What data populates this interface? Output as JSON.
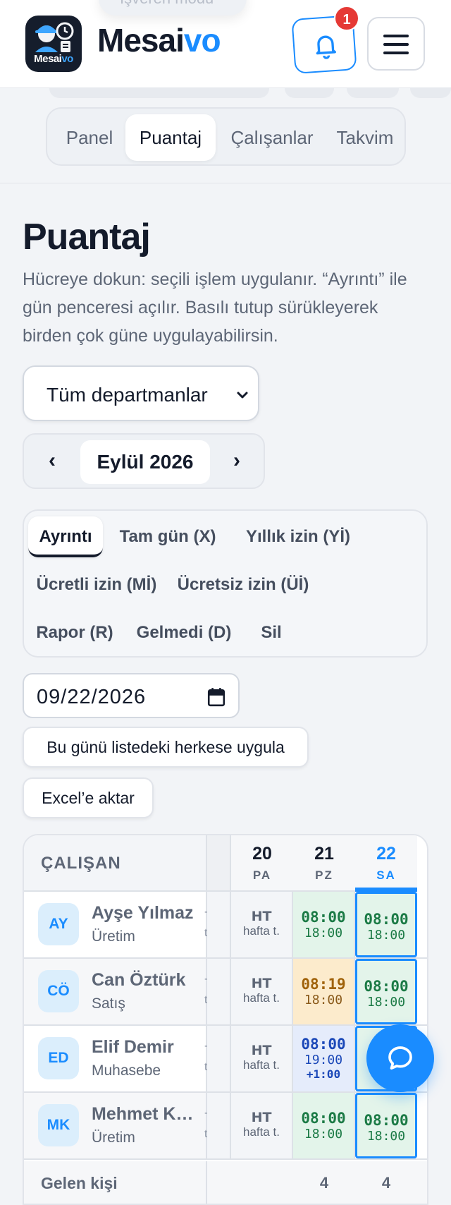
{
  "header": {
    "ghost_pill": "İşveren modu",
    "logo_text_main": "Mesai",
    "logo_text_accent": "vo",
    "brand_main": "Mesai",
    "brand_accent": "vo",
    "notification_count": "1"
  },
  "nav": {
    "tabs": [
      {
        "label": "Panel"
      },
      {
        "label": "Puantaj"
      },
      {
        "label": "Çalışanlar"
      },
      {
        "label": "Takvim"
      }
    ],
    "active": "Puantaj"
  },
  "page": {
    "title": "Puantaj",
    "description": "Hücreye dokun: seçili işlem uygulanır. “Ayrıntı” ile gün penceresi açılır. Basılı tutup sürükleyerek birden çok güne uygulayabilirsin."
  },
  "department_select": {
    "value": "Tüm departmanlar"
  },
  "month_nav": {
    "prev": "‹",
    "label": "Eylül 2026",
    "next": "›"
  },
  "actions": [
    {
      "label": "Ayrıntı"
    },
    {
      "label": "Tam gün (X)"
    },
    {
      "label": "Yıllık izin (Yİ)"
    },
    {
      "label": "Ücretli izin (Mİ)"
    },
    {
      "label": "Ücretsiz izin (Üİ)"
    },
    {
      "label": "Rapor (R)"
    },
    {
      "label": "Gelmedi (D)"
    },
    {
      "label": "Sil"
    }
  ],
  "active_action": "Ayrıntı",
  "date_input": {
    "value": "09/22/2026"
  },
  "buttons": {
    "apply_all": "Bu günü listedeki herkese uygula",
    "export_excel": "Excel’e aktar"
  },
  "table": {
    "employee_header": "ÇALIŞAN",
    "days": [
      {
        "num": "20",
        "dow": "PA"
      },
      {
        "num": "21",
        "dow": "PZ"
      },
      {
        "num": "22",
        "dow": "SA"
      }
    ],
    "today": "22",
    "rows": [
      {
        "initials": "AY",
        "name": "Ayşe Yılmaz",
        "dept": "Üretim",
        "edge_top": "-",
        "edge_bottom": "t.",
        "cells": [
          {
            "l1": "HT",
            "l2": "hafta t.",
            "status": "weekly-off"
          },
          {
            "l1": "08:00",
            "l2": "18:00",
            "status": "on-time"
          },
          {
            "l1": "08:00",
            "l2": "18:00",
            "status": "on-time"
          }
        ]
      },
      {
        "initials": "CÖ",
        "name": "Can Öztürk",
        "dept": "Satış",
        "edge_top": "-",
        "edge_bottom": "t.",
        "cells": [
          {
            "l1": "HT",
            "l2": "hafta t.",
            "status": "weekly-off"
          },
          {
            "l1": "08:19",
            "l2": "18:00",
            "status": "late"
          },
          {
            "l1": "08:00",
            "l2": "18:00",
            "status": "on-time"
          }
        ]
      },
      {
        "initials": "ED",
        "name": "Elif Demir",
        "dept": "Muhasebe",
        "edge_top": "-",
        "edge_bottom": "t.",
        "cells": [
          {
            "l1": "HT",
            "l2": "hafta t.",
            "status": "weekly-off"
          },
          {
            "l1": "08:00",
            "l2": "19:00",
            "l3": "+1:00",
            "status": "overtime"
          },
          {
            "l1": "",
            "l2": "",
            "status": "hidden-by-fab"
          }
        ]
      },
      {
        "initials": "MK",
        "name": "Mehmet Kaya",
        "dept": "Üretim",
        "edge_top": "-",
        "edge_bottom": "t.",
        "cells": [
          {
            "l1": "HT",
            "l2": "hafta t.",
            "status": "weekly-off"
          },
          {
            "l1": "08:00",
            "l2": "18:00",
            "status": "on-time"
          },
          {
            "l1": "08:00",
            "l2": "18:00",
            "status": "on-time"
          }
        ]
      }
    ],
    "footer": {
      "label": "Gelen kişi",
      "counts": [
        "",
        "4",
        "4"
      ]
    }
  },
  "colors": {
    "accent": "#1a8cff",
    "ok_bg": "#e3f4ea",
    "late_bg": "#fcebcc",
    "overtime_bg": "#e5ecfb",
    "badge": "#e53935"
  },
  "icons": {
    "notification": "bell-icon",
    "menu": "hamburger-menu-icon",
    "calendar": "calendar-icon",
    "chat": "chat-bubble-icon",
    "select": "chevron-down-icon"
  }
}
